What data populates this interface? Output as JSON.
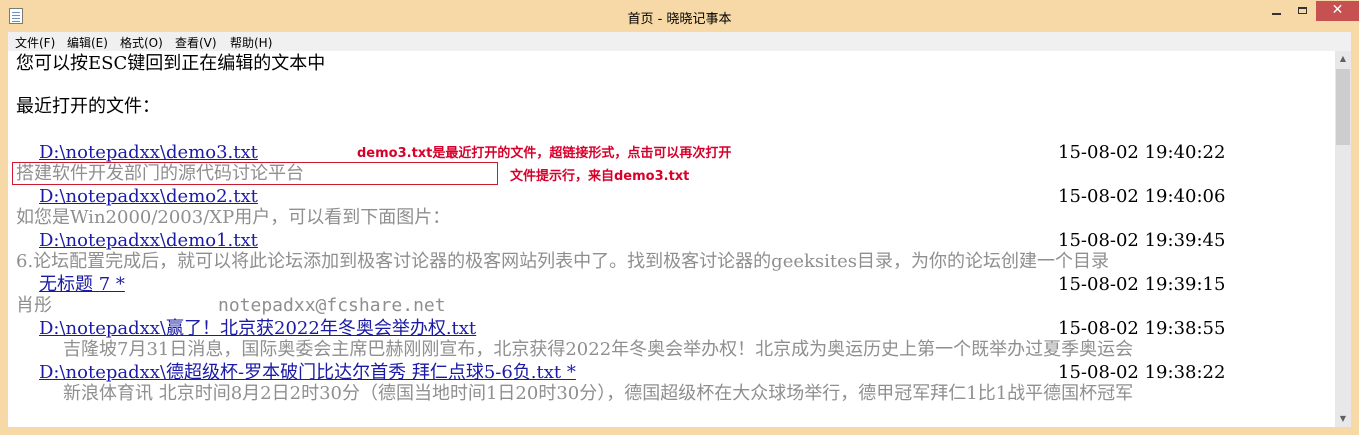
{
  "window": {
    "title": "首页 - 晓晓记事本",
    "close_glyph": "✕"
  },
  "menu": [
    {
      "label": "文件(F)"
    },
    {
      "label": "编辑(E)"
    },
    {
      "label": "格式(O)"
    },
    {
      "label": "查看(V)"
    },
    {
      "label": "帮助(H)"
    }
  ],
  "content": {
    "hint_line": "您可以按ESC键回到正在编辑的文本中",
    "recent_heading": "最近打开的文件：",
    "recent_files": [
      {
        "path": "D:\\notepadxx\\demo3.txt",
        "time": "15-08-02 19:40:22",
        "prompt": "搭建软件开发部门的源代码讨论平台"
      },
      {
        "path": "D:\\notepadxx\\demo2.txt",
        "time": "15-08-02 19:40:06",
        "prompt": "如您是Win2000/2003/XP用户，可以看到下面图片："
      },
      {
        "path": "D:\\notepadxx\\demo1.txt",
        "time": "15-08-02 19:39:45",
        "prompt": "6.论坛配置完成后，就可以将此论坛添加到极客讨论器的极客网站列表中了。找到极客讨论器的geeksites目录，为你的论坛创建一个目录"
      },
      {
        "path": "无标题 7 *",
        "time": "15-08-02 19:39:15",
        "prompt": "肖彤",
        "extra": "notepadxx@fcshare.net"
      },
      {
        "path": "D:\\notepadxx\\赢了！北京获2022年冬奥会举办权.txt",
        "time": "15-08-02 19:38:55",
        "prompt": "吉隆坡7月31日消息，国际奥委会主席巴赫刚刚宣布，北京获得2022年冬奥会举办权！北京成为奥运历史上第一个既举办过夏季奥运会"
      },
      {
        "path": "D:\\notepadxx\\德超级杯-罗本破门比达尔首秀 拜仁点球5-6负.txt *",
        "time": "15-08-02 19:38:22",
        "prompt": "新浪体育讯    北京时间8月2日2时30分（德国当地时间1日20时30分），德国超级杯在大众球场举行，德甲冠军拜仁1比1战平德国杯冠军"
      }
    ]
  },
  "annotations": {
    "link_note": "demo3.txt是最近打开的文件，超链接形式，点击可以再次打开",
    "prompt_note": "文件提示行，来自demo3.txt"
  },
  "scrollbar": {
    "up_icon": "▲",
    "down_icon": "▼"
  },
  "colors": {
    "frame": "#f6d9a6",
    "link": "#1a1aa6",
    "prompt": "#8f8f8f",
    "annotation": "#d8002a",
    "close_button": "#c75050"
  }
}
